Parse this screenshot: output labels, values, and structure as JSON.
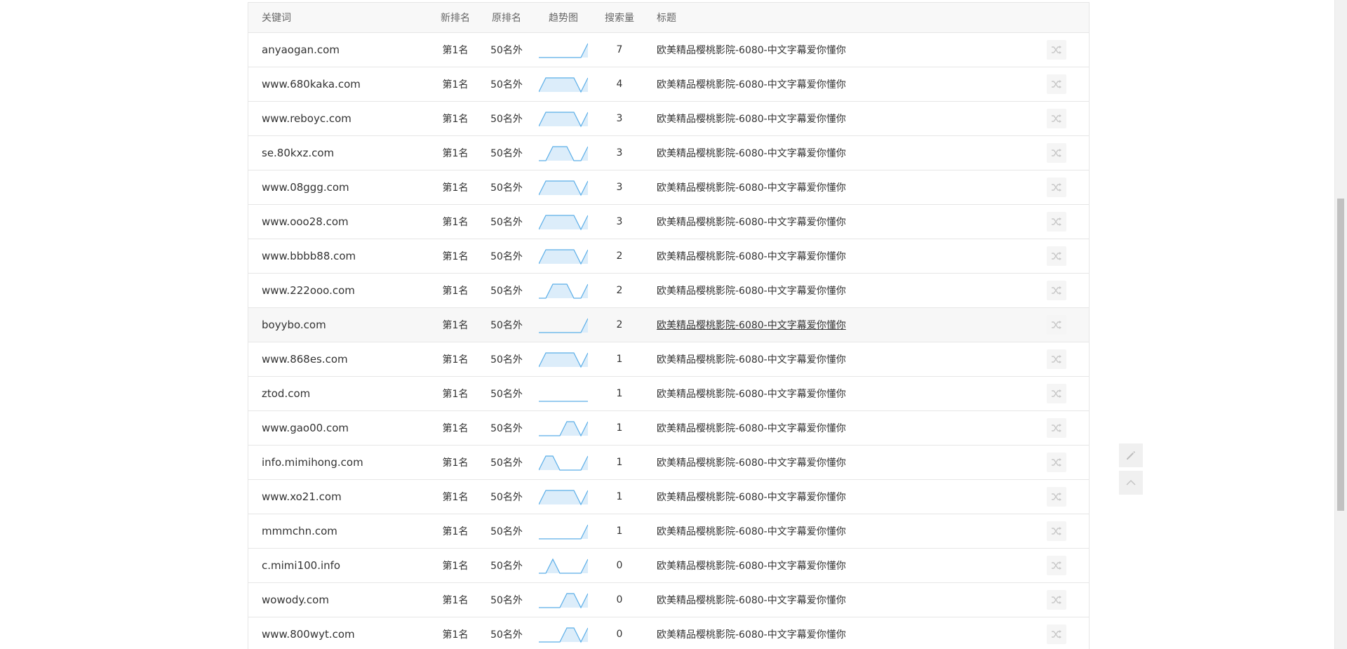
{
  "table": {
    "headers": {
      "keyword": "关键词",
      "new_rank": "新排名",
      "old_rank": "原排名",
      "trend": "趋势图",
      "volume": "搜索量",
      "title": "标题"
    },
    "rows": [
      {
        "keyword": "anyaogan.com",
        "new_rank": "第1名",
        "old_rank": "50名外",
        "volume": "7",
        "title": "欧美精品樱桃影院-6080-中文字幕爱你懂你",
        "trend": [
          0,
          0,
          0,
          0,
          0,
          0,
          0,
          1
        ]
      },
      {
        "keyword": "www.680kaka.com",
        "new_rank": "第1名",
        "old_rank": "50名外",
        "volume": "4",
        "title": "欧美精品樱桃影院-6080-中文字幕爱你懂你",
        "trend": [
          0,
          1,
          1,
          1,
          1,
          1,
          0,
          1
        ]
      },
      {
        "keyword": "www.reboyc.com",
        "new_rank": "第1名",
        "old_rank": "50名外",
        "volume": "3",
        "title": "欧美精品樱桃影院-6080-中文字幕爱你懂你",
        "trend": [
          0,
          1,
          1,
          1,
          1,
          1,
          0,
          1
        ]
      },
      {
        "keyword": "se.80kxz.com",
        "new_rank": "第1名",
        "old_rank": "50名外",
        "volume": "3",
        "title": "欧美精品樱桃影院-6080-中文字幕爱你懂你",
        "trend": [
          0,
          0,
          1,
          1,
          1,
          0,
          0,
          1
        ]
      },
      {
        "keyword": "www.08ggg.com",
        "new_rank": "第1名",
        "old_rank": "50名外",
        "volume": "3",
        "title": "欧美精品樱桃影院-6080-中文字幕爱你懂你",
        "trend": [
          0,
          1,
          1,
          1,
          1,
          1,
          0,
          1
        ]
      },
      {
        "keyword": "www.ooo28.com",
        "new_rank": "第1名",
        "old_rank": "50名外",
        "volume": "3",
        "title": "欧美精品樱桃影院-6080-中文字幕爱你懂你",
        "trend": [
          0,
          1,
          1,
          1,
          1,
          1,
          0,
          1
        ]
      },
      {
        "keyword": "www.bbbb88.com",
        "new_rank": "第1名",
        "old_rank": "50名外",
        "volume": "2",
        "title": "欧美精品樱桃影院-6080-中文字幕爱你懂你",
        "trend": [
          0,
          1,
          1,
          1,
          1,
          1,
          0,
          1
        ]
      },
      {
        "keyword": "www.222ooo.com",
        "new_rank": "第1名",
        "old_rank": "50名外",
        "volume": "2",
        "title": "欧美精品樱桃影院-6080-中文字幕爱你懂你",
        "trend": [
          0,
          0,
          1,
          1,
          1,
          0,
          0,
          1
        ]
      },
      {
        "keyword": "boyybo.com",
        "new_rank": "第1名",
        "old_rank": "50名外",
        "volume": "2",
        "title": "欧美精品樱桃影院-6080-中文字幕爱你懂你",
        "trend": [
          0,
          0,
          0,
          0,
          0,
          0,
          0,
          1
        ],
        "highlight": true
      },
      {
        "keyword": "www.868es.com",
        "new_rank": "第1名",
        "old_rank": "50名外",
        "volume": "1",
        "title": "欧美精品樱桃影院-6080-中文字幕爱你懂你",
        "trend": [
          0,
          1,
          1,
          1,
          1,
          1,
          0,
          1
        ]
      },
      {
        "keyword": "ztod.com",
        "new_rank": "第1名",
        "old_rank": "50名外",
        "volume": "1",
        "title": "欧美精品樱桃影院-6080-中文字幕爱你懂你",
        "trend": [
          0,
          0,
          0,
          0,
          0,
          0,
          0,
          0
        ]
      },
      {
        "keyword": "www.gao00.com",
        "new_rank": "第1名",
        "old_rank": "50名外",
        "volume": "1",
        "title": "欧美精品樱桃影院-6080-中文字幕爱你懂你",
        "trend": [
          0,
          0,
          0,
          0,
          1,
          1,
          0,
          1
        ]
      },
      {
        "keyword": "info.mimihong.com",
        "new_rank": "第1名",
        "old_rank": "50名外",
        "volume": "1",
        "title": "欧美精品樱桃影院-6080-中文字幕爱你懂你",
        "trend": [
          0,
          1,
          1,
          0,
          0,
          0,
          0,
          1
        ]
      },
      {
        "keyword": "www.xo21.com",
        "new_rank": "第1名",
        "old_rank": "50名外",
        "volume": "1",
        "title": "欧美精品樱桃影院-6080-中文字幕爱你懂你",
        "trend": [
          0,
          1,
          1,
          1,
          1,
          1,
          0,
          1
        ]
      },
      {
        "keyword": "mmmchn.com",
        "new_rank": "第1名",
        "old_rank": "50名外",
        "volume": "1",
        "title": "欧美精品樱桃影院-6080-中文字幕爱你懂你",
        "trend": [
          0,
          0,
          0,
          0,
          0,
          0,
          0,
          1
        ]
      },
      {
        "keyword": "c.mimi100.info",
        "new_rank": "第1名",
        "old_rank": "50名外",
        "volume": "0",
        "title": "欧美精品樱桃影院-6080-中文字幕爱你懂你",
        "trend": [
          0,
          0,
          1,
          0,
          0,
          0,
          0,
          1
        ]
      },
      {
        "keyword": "wowody.com",
        "new_rank": "第1名",
        "old_rank": "50名外",
        "volume": "0",
        "title": "欧美精品樱桃影院-6080-中文字幕爱你懂你",
        "trend": [
          0,
          0,
          0,
          0,
          1,
          1,
          0,
          1
        ]
      },
      {
        "keyword": "www.800wyt.com",
        "new_rank": "第1名",
        "old_rank": "50名外",
        "volume": "0",
        "title": "欧美精品樱桃影院-6080-中文字幕爱你懂你",
        "trend": [
          0,
          0,
          0,
          0,
          1,
          1,
          0,
          1
        ]
      }
    ]
  },
  "icons": {
    "row_action": "shuffle-icon",
    "edit": "pencil-icon",
    "back_to_top": "chevron-up-icon"
  },
  "colors": {
    "sparkline_stroke": "#5aaee8",
    "sparkline_fill": "#dcedfa",
    "border": "#e6e6e6"
  }
}
